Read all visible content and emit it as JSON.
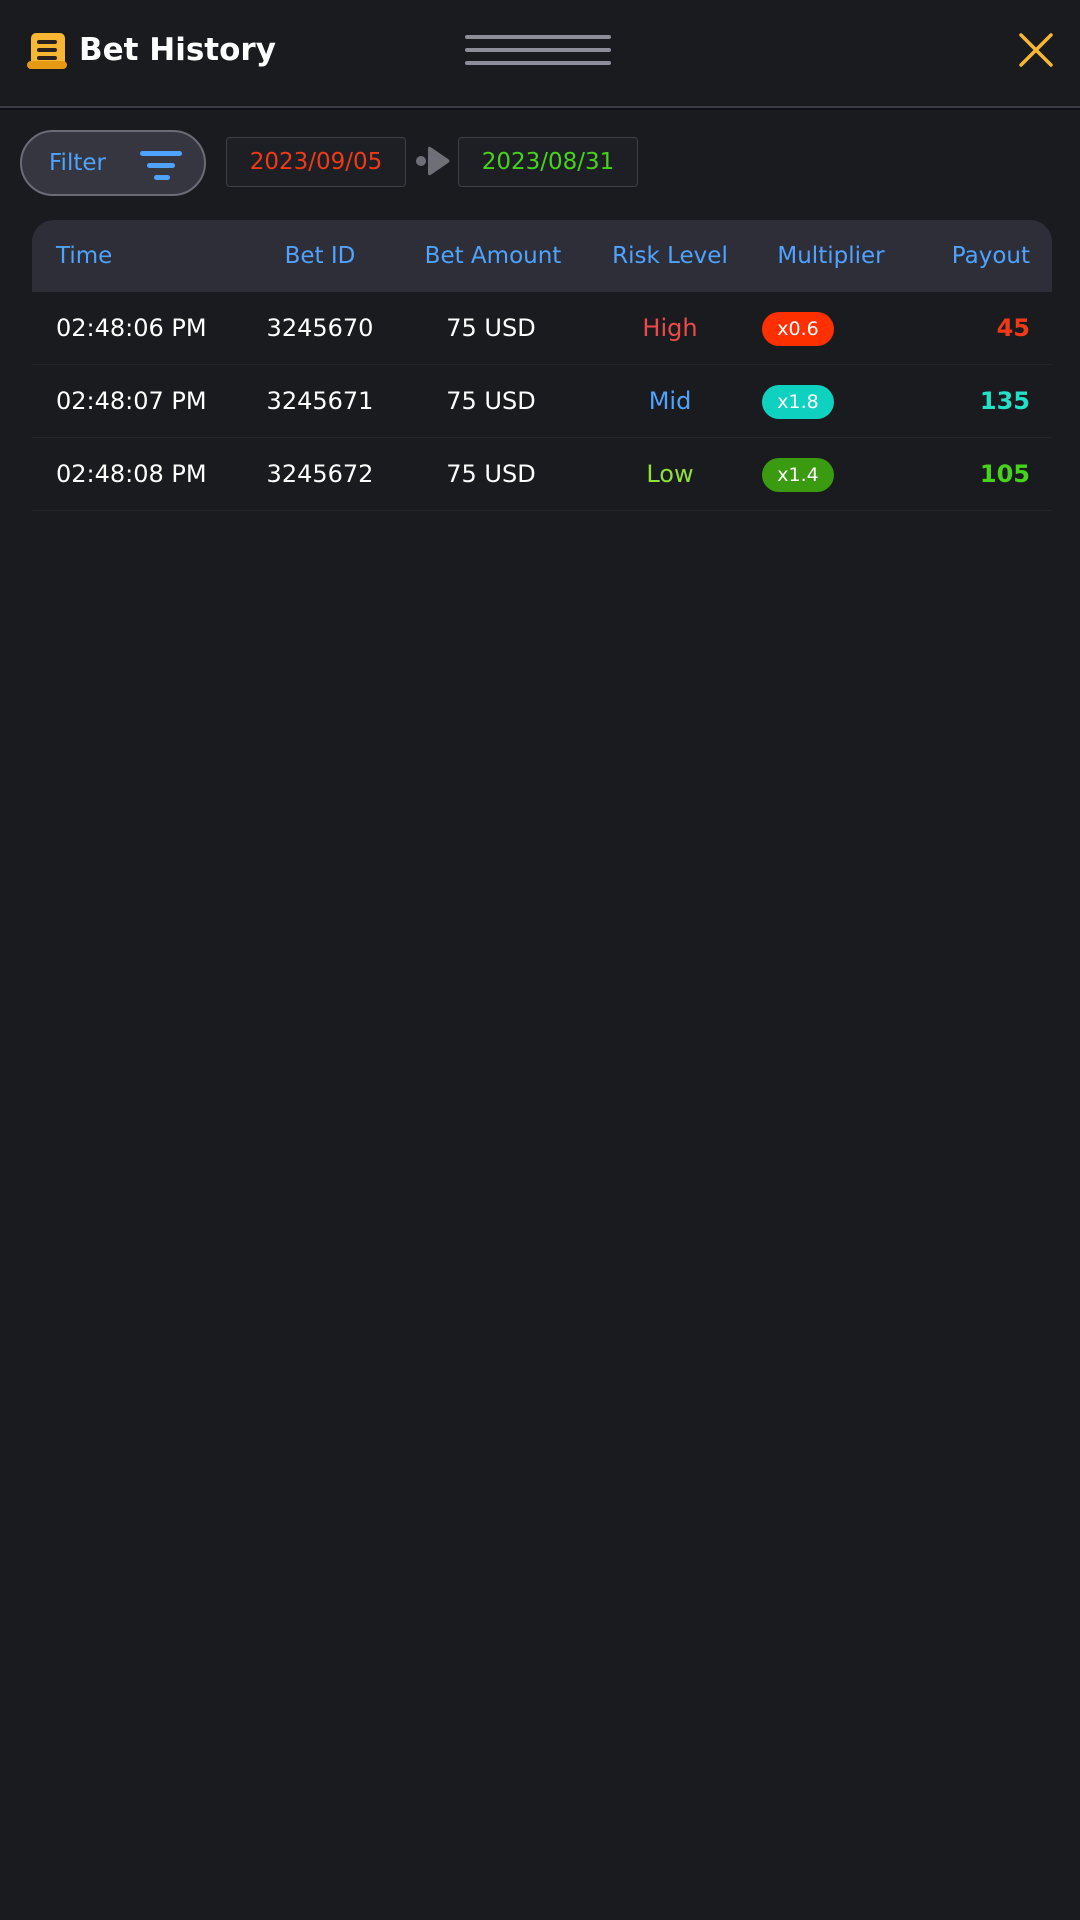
{
  "header": {
    "title": "Bet History",
    "accent": "#f7b733"
  },
  "filter": {
    "label": "Filter",
    "date_from": "2023/09/05",
    "date_to": "2023/08/31",
    "date_from_color": "#f03a17",
    "date_to_color": "#46d41a"
  },
  "table": {
    "columns": [
      "Time",
      "Bet ID",
      "Bet Amount",
      "Risk Level",
      "Multiplier",
      "Payout"
    ],
    "rows": [
      {
        "time": "02:48:06 PM",
        "bet_id": "3245670",
        "amount": "75 USD",
        "risk": "High",
        "risk_color": "#ef4a4a",
        "multiplier": "x0.6",
        "multiplier_color": "#ff3000",
        "payout": "45",
        "payout_color": "#f03a17"
      },
      {
        "time": "02:48:07 PM",
        "bet_id": "3245671",
        "amount": "75 USD",
        "risk": "Mid",
        "risk_color": "#4fa3ff",
        "multiplier": "x1.8",
        "multiplier_color": "#0fd1c0",
        "payout": "135",
        "payout_color": "#23e0c6"
      },
      {
        "time": "02:48:08 PM",
        "bet_id": "3245672",
        "amount": "75 USD",
        "risk": "Low",
        "risk_color": "#8ee03a",
        "multiplier": "x1.4",
        "multiplier_color": "#3a9a10",
        "payout": "105",
        "payout_color": "#46d41a"
      }
    ]
  }
}
